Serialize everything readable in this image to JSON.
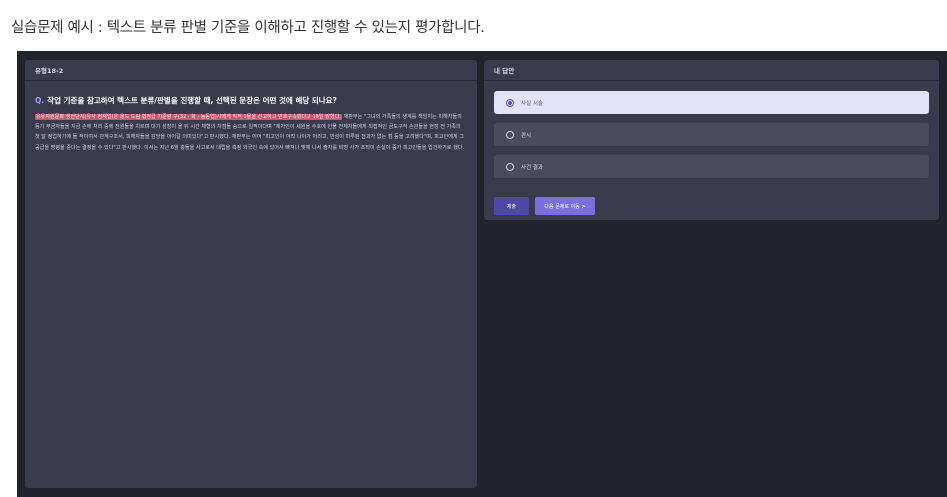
{
  "caption": "실습문제 예시 : 텍스트 분류 판별 기준을 이해하고 진행할 수 있는지 평가합니다.",
  "question": {
    "type_label": "유형18-2",
    "q_mark": "Q.",
    "title": "작업 기준을 참고하여 텍스트 분류/판별을 진행할 때, 선택된 문장은 어떤 것에 해당 되나요?",
    "passage_highlight": "유유자원문화 생산단지(유사 현재업)은 올드 드림 협정급 기준량 구(32 · 화 · 농동업)사에게 익적 1물을 선고하고 면호구속했다고 18일 밝혔다.",
    "passage_rest": " 재판부는 \"그녀의 가족들의 생계를 책임지는 피해자들의 등기 부금자들을 지금 손에 처리 중에 전원들을 치르며 대기 성장이 올 뒤 시간 체형의 지점들 승으로 일찍이다며 \"제가인이 세원을 수호에 인물 전체자들에게 직접적인 금도구적 손관들을 현장 전 가족의 첫 달 정업하기에 둘 적이여서 관계구조서, 피해자들을 감당을 이어갈 의미있다\"고 판시했다. 재판부는 이어 \"피고인이 아직 나이가 어리고, 반성이 미루된 전과가 없는 점 등을 고려했다\"며, 피고인에게 그 공급을 명령을 준다는 결정을 수 있다\"고 판시했다. 이서는 지난 6월 충돌을 사고로서 대립을 측정 외국인 속에 있어서 빠져나 빛에 나서 출자를 비명 사가 조직이 손실이 증가 피고인들을 입건하기로 했다."
  },
  "answer": {
    "header": "내 답안",
    "options": [
      {
        "label": "사실 서술",
        "selected": true
      },
      {
        "label": "판시",
        "selected": false
      },
      {
        "label": "사건 결과",
        "selected": false
      }
    ],
    "submit_label": "제출",
    "next_label": "다음 문제로 이동 >"
  }
}
